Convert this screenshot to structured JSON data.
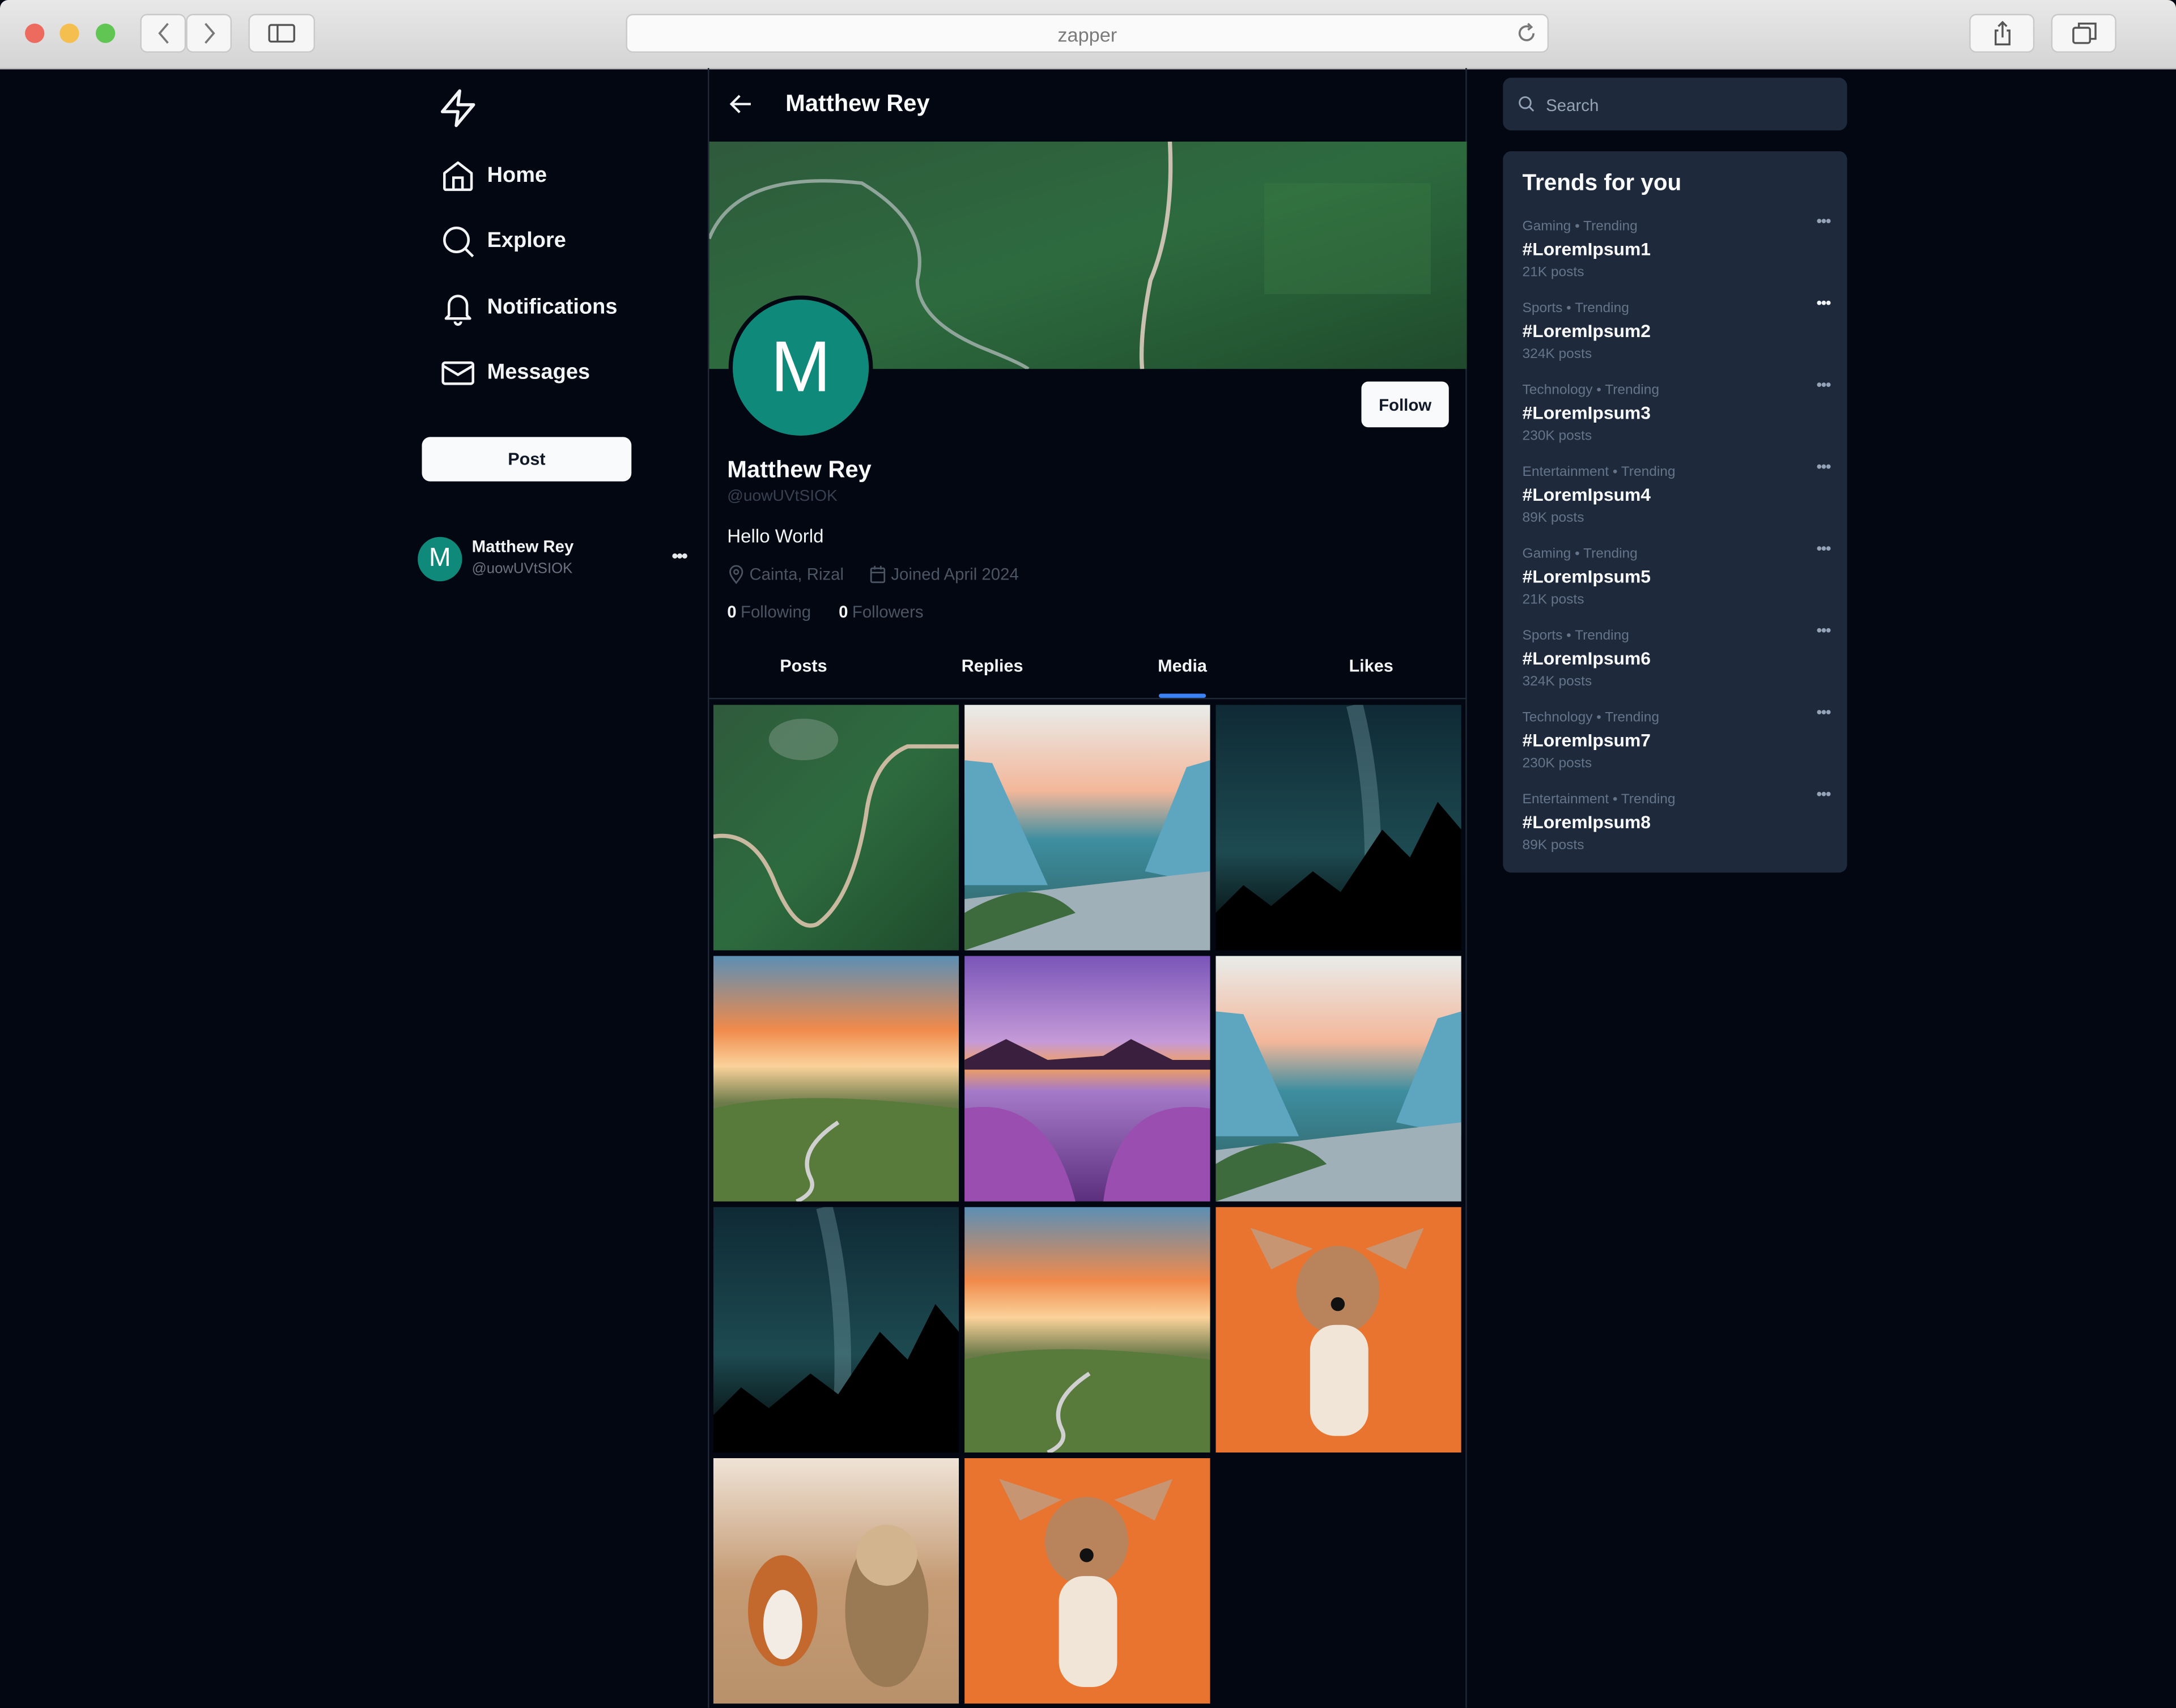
{
  "browser": {
    "url": "zapper"
  },
  "sidebar": {
    "items": [
      {
        "label": "Home",
        "icon": "home-icon"
      },
      {
        "label": "Explore",
        "icon": "search-icon"
      },
      {
        "label": "Notifications",
        "icon": "bell-icon"
      },
      {
        "label": "Messages",
        "icon": "mail-icon"
      }
    ],
    "post_label": "Post",
    "account": {
      "initial": "M",
      "name": "Matthew Rey",
      "handle": "@uowUVtSIOK",
      "more": "•••"
    }
  },
  "profile": {
    "header_title": "Matthew Rey",
    "avatar_initial": "M",
    "follow_label": "Follow",
    "name": "Matthew Rey",
    "handle": "@uowUVtSIOK",
    "bio": "Hello World",
    "location": "Cainta, Rizal",
    "joined": "Joined April 2024",
    "following_count": "0",
    "following_label": "Following",
    "followers_count": "0",
    "followers_label": "Followers",
    "tabs": [
      {
        "label": "Posts"
      },
      {
        "label": "Replies"
      },
      {
        "label": "Media"
      },
      {
        "label": "Likes"
      }
    ],
    "active_tab": "Media",
    "media": [
      {
        "subject": "green mountain road aerial"
      },
      {
        "subject": "valley river at sunset"
      },
      {
        "subject": "milky way over forest"
      },
      {
        "subject": "rolling hills at sunset"
      },
      {
        "subject": "purple lavender lake"
      },
      {
        "subject": "valley river at sunset"
      },
      {
        "subject": "milky way over forest"
      },
      {
        "subject": "rolling hills at sunset"
      },
      {
        "subject": "corgi puppy on orange"
      },
      {
        "subject": "two dogs running"
      },
      {
        "subject": "corgi puppy on orange"
      }
    ]
  },
  "right": {
    "search_placeholder": "Search",
    "trends_title": "Trends for you",
    "trends": [
      {
        "category": "Gaming • Trending",
        "tag": "#LoremIpsum1",
        "count": "21K posts"
      },
      {
        "category": "Sports • Trending",
        "tag": "#LoremIpsum2",
        "count": "324K posts"
      },
      {
        "category": "Technology • Trending",
        "tag": "#LoremIpsum3",
        "count": "230K posts"
      },
      {
        "category": "Entertainment • Trending",
        "tag": "#LoremIpsum4",
        "count": "89K posts"
      },
      {
        "category": "Gaming • Trending",
        "tag": "#LoremIpsum5",
        "count": "21K posts"
      },
      {
        "category": "Sports • Trending",
        "tag": "#LoremIpsum6",
        "count": "324K posts"
      },
      {
        "category": "Technology • Trending",
        "tag": "#LoremIpsum7",
        "count": "230K posts"
      },
      {
        "category": "Entertainment • Trending",
        "tag": "#LoremIpsum8",
        "count": "89K posts"
      }
    ],
    "more_glyph": "•••"
  },
  "colors": {
    "background": "#030712",
    "panel": "#1e293b",
    "accent": "#3b82f6",
    "avatar": "#0f8a7a"
  }
}
